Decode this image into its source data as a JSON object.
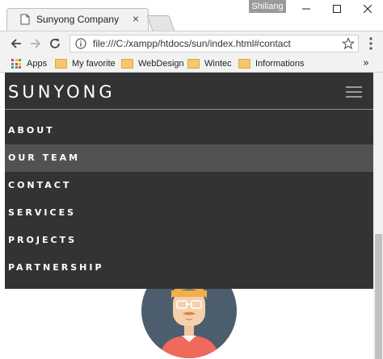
{
  "browser": {
    "tab_title": "Sunyong Company",
    "profile_name": "Shiliang",
    "url": "file:///C:/xampp/htdocs/sun/index.html#contact",
    "bookmarks": [
      {
        "label": "Apps",
        "icon": "apps-grid-icon"
      },
      {
        "label": "My favorite",
        "icon": "folder-icon"
      },
      {
        "label": "WebDesign",
        "icon": "folder-icon"
      },
      {
        "label": "Wintec",
        "icon": "folder-icon"
      },
      {
        "label": "Informations",
        "icon": "folder-icon"
      }
    ]
  },
  "site": {
    "brand": "SUNYONG",
    "nav_items": [
      "ABOUT",
      "OUR TEAM",
      "CONTACT",
      "SERVICES",
      "PROJECTS",
      "PARTNERSHIP"
    ],
    "active_nav_item": "OUR TEAM"
  },
  "colors": {
    "nav_background": "#333333",
    "nav_active": "#525252",
    "avatar_circle": "#4c5e6d",
    "avatar_shirt": "#ef6a5b"
  }
}
